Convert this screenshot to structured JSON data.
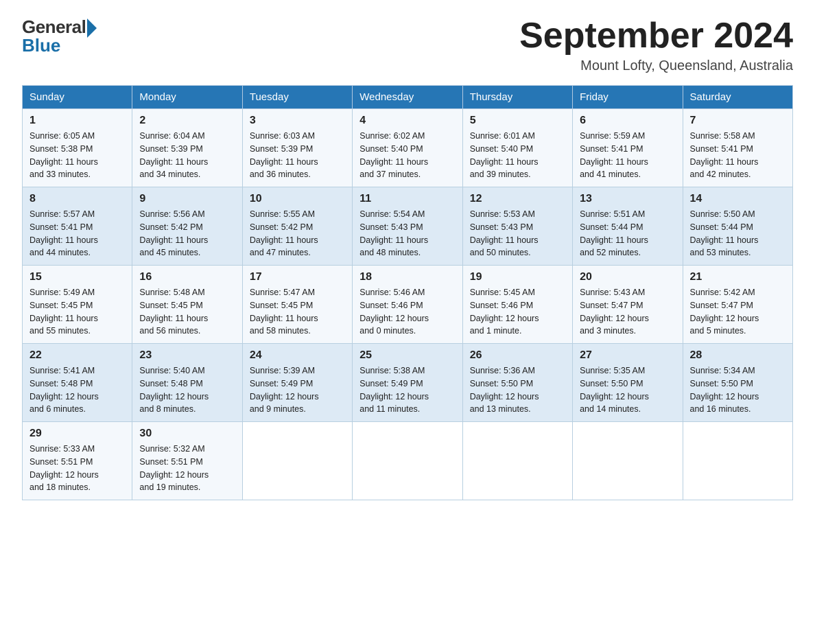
{
  "logo": {
    "general": "General",
    "arrow": "",
    "blue": "Blue"
  },
  "title": "September 2024",
  "location": "Mount Lofty, Queensland, Australia",
  "days_of_week": [
    "Sunday",
    "Monday",
    "Tuesday",
    "Wednesday",
    "Thursday",
    "Friday",
    "Saturday"
  ],
  "weeks": [
    [
      {
        "date": "1",
        "sunrise": "6:05 AM",
        "sunset": "5:38 PM",
        "daylight": "11 hours and 33 minutes."
      },
      {
        "date": "2",
        "sunrise": "6:04 AM",
        "sunset": "5:39 PM",
        "daylight": "11 hours and 34 minutes."
      },
      {
        "date": "3",
        "sunrise": "6:03 AM",
        "sunset": "5:39 PM",
        "daylight": "11 hours and 36 minutes."
      },
      {
        "date": "4",
        "sunrise": "6:02 AM",
        "sunset": "5:40 PM",
        "daylight": "11 hours and 37 minutes."
      },
      {
        "date": "5",
        "sunrise": "6:01 AM",
        "sunset": "5:40 PM",
        "daylight": "11 hours and 39 minutes."
      },
      {
        "date": "6",
        "sunrise": "5:59 AM",
        "sunset": "5:41 PM",
        "daylight": "11 hours and 41 minutes."
      },
      {
        "date": "7",
        "sunrise": "5:58 AM",
        "sunset": "5:41 PM",
        "daylight": "11 hours and 42 minutes."
      }
    ],
    [
      {
        "date": "8",
        "sunrise": "5:57 AM",
        "sunset": "5:41 PM",
        "daylight": "11 hours and 44 minutes."
      },
      {
        "date": "9",
        "sunrise": "5:56 AM",
        "sunset": "5:42 PM",
        "daylight": "11 hours and 45 minutes."
      },
      {
        "date": "10",
        "sunrise": "5:55 AM",
        "sunset": "5:42 PM",
        "daylight": "11 hours and 47 minutes."
      },
      {
        "date": "11",
        "sunrise": "5:54 AM",
        "sunset": "5:43 PM",
        "daylight": "11 hours and 48 minutes."
      },
      {
        "date": "12",
        "sunrise": "5:53 AM",
        "sunset": "5:43 PM",
        "daylight": "11 hours and 50 minutes."
      },
      {
        "date": "13",
        "sunrise": "5:51 AM",
        "sunset": "5:44 PM",
        "daylight": "11 hours and 52 minutes."
      },
      {
        "date": "14",
        "sunrise": "5:50 AM",
        "sunset": "5:44 PM",
        "daylight": "11 hours and 53 minutes."
      }
    ],
    [
      {
        "date": "15",
        "sunrise": "5:49 AM",
        "sunset": "5:45 PM",
        "daylight": "11 hours and 55 minutes."
      },
      {
        "date": "16",
        "sunrise": "5:48 AM",
        "sunset": "5:45 PM",
        "daylight": "11 hours and 56 minutes."
      },
      {
        "date": "17",
        "sunrise": "5:47 AM",
        "sunset": "5:45 PM",
        "daylight": "11 hours and 58 minutes."
      },
      {
        "date": "18",
        "sunrise": "5:46 AM",
        "sunset": "5:46 PM",
        "daylight": "12 hours and 0 minutes."
      },
      {
        "date": "19",
        "sunrise": "5:45 AM",
        "sunset": "5:46 PM",
        "daylight": "12 hours and 1 minute."
      },
      {
        "date": "20",
        "sunrise": "5:43 AM",
        "sunset": "5:47 PM",
        "daylight": "12 hours and 3 minutes."
      },
      {
        "date": "21",
        "sunrise": "5:42 AM",
        "sunset": "5:47 PM",
        "daylight": "12 hours and 5 minutes."
      }
    ],
    [
      {
        "date": "22",
        "sunrise": "5:41 AM",
        "sunset": "5:48 PM",
        "daylight": "12 hours and 6 minutes."
      },
      {
        "date": "23",
        "sunrise": "5:40 AM",
        "sunset": "5:48 PM",
        "daylight": "12 hours and 8 minutes."
      },
      {
        "date": "24",
        "sunrise": "5:39 AM",
        "sunset": "5:49 PM",
        "daylight": "12 hours and 9 minutes."
      },
      {
        "date": "25",
        "sunrise": "5:38 AM",
        "sunset": "5:49 PM",
        "daylight": "12 hours and 11 minutes."
      },
      {
        "date": "26",
        "sunrise": "5:36 AM",
        "sunset": "5:50 PM",
        "daylight": "12 hours and 13 minutes."
      },
      {
        "date": "27",
        "sunrise": "5:35 AM",
        "sunset": "5:50 PM",
        "daylight": "12 hours and 14 minutes."
      },
      {
        "date": "28",
        "sunrise": "5:34 AM",
        "sunset": "5:50 PM",
        "daylight": "12 hours and 16 minutes."
      }
    ],
    [
      {
        "date": "29",
        "sunrise": "5:33 AM",
        "sunset": "5:51 PM",
        "daylight": "12 hours and 18 minutes."
      },
      {
        "date": "30",
        "sunrise": "5:32 AM",
        "sunset": "5:51 PM",
        "daylight": "12 hours and 19 minutes."
      },
      null,
      null,
      null,
      null,
      null
    ]
  ],
  "labels": {
    "sunrise": "Sunrise:",
    "sunset": "Sunset:",
    "daylight": "Daylight:"
  }
}
